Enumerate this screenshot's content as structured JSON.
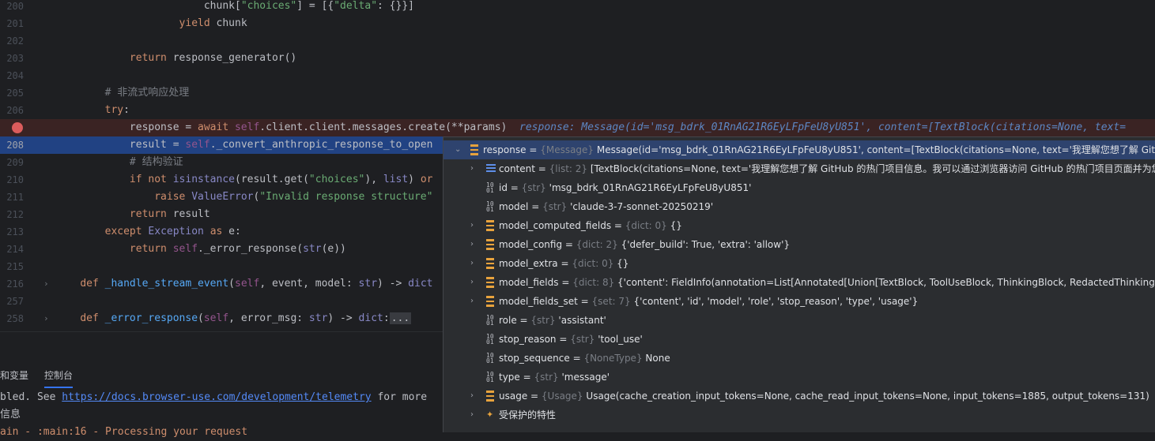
{
  "editor": {
    "lines": [
      {
        "num": "200",
        "code": [
          [
            "",
            "                        chunk["
          ],
          [
            "str",
            "\"choices\""
          ],
          [
            "",
            "] = [{"
          ],
          [
            "str",
            "\"delta\""
          ],
          [
            "",
            ": {}}]"
          ]
        ]
      },
      {
        "num": "201",
        "code": [
          [
            "",
            "                    "
          ],
          [
            "kw",
            "yield"
          ],
          [
            "",
            " chunk"
          ]
        ]
      },
      {
        "num": "202",
        "code": [
          [
            "",
            ""
          ]
        ]
      },
      {
        "num": "203",
        "code": [
          [
            "",
            "            "
          ],
          [
            "kw",
            "return"
          ],
          [
            "",
            " response_generator()"
          ]
        ]
      },
      {
        "num": "204",
        "code": [
          [
            "",
            ""
          ]
        ]
      },
      {
        "num": "205",
        "code": [
          [
            "",
            "        "
          ],
          [
            "cm",
            "# 非流式响应处理"
          ]
        ]
      },
      {
        "num": "206",
        "code": [
          [
            "",
            "        "
          ],
          [
            "kw",
            "try"
          ],
          [
            "",
            ":"
          ]
        ]
      },
      {
        "num": "",
        "code": [
          [
            "",
            "            response = "
          ],
          [
            "kw",
            "await"
          ],
          [
            "",
            " "
          ],
          [
            "self",
            "self"
          ],
          [
            "",
            ".client.client.messages.create(**params)  "
          ],
          [
            "inline-hint",
            "response: Message(id='msg_bdrk_01RnAG21R6EyLFpFeU8yU851', content=[TextBlock(citations=None, text="
          ]
        ]
      },
      {
        "num": "208",
        "code": [
          [
            "",
            "            result = "
          ],
          [
            "self",
            "self"
          ],
          [
            "",
            "._convert_anthropic_response_to_open"
          ]
        ]
      },
      {
        "num": "209",
        "code": [
          [
            "",
            "            "
          ],
          [
            "cm",
            "# 结构验证"
          ]
        ]
      },
      {
        "num": "210",
        "code": [
          [
            "",
            "            "
          ],
          [
            "kw",
            "if not"
          ],
          [
            "",
            " "
          ],
          [
            "bi",
            "isinstance"
          ],
          [
            "",
            "(result.get("
          ],
          [
            "str",
            "\"choices\""
          ],
          [
            "",
            "), "
          ],
          [
            "bi",
            "list"
          ],
          [
            "",
            ") "
          ],
          [
            "kw",
            "or"
          ]
        ]
      },
      {
        "num": "211",
        "code": [
          [
            "",
            "                "
          ],
          [
            "kw",
            "raise"
          ],
          [
            "",
            " "
          ],
          [
            "bi",
            "ValueError"
          ],
          [
            "",
            "("
          ],
          [
            "str",
            "\"Invalid response structure\""
          ]
        ]
      },
      {
        "num": "212",
        "code": [
          [
            "",
            "            "
          ],
          [
            "kw",
            "return"
          ],
          [
            "",
            " result"
          ]
        ]
      },
      {
        "num": "213",
        "code": [
          [
            "",
            "        "
          ],
          [
            "kw",
            "except"
          ],
          [
            "",
            " "
          ],
          [
            "bi",
            "Exception"
          ],
          [
            "",
            " "
          ],
          [
            "kw",
            "as"
          ],
          [
            "",
            " e:"
          ]
        ]
      },
      {
        "num": "214",
        "code": [
          [
            "",
            "            "
          ],
          [
            "kw",
            "return"
          ],
          [
            "",
            " "
          ],
          [
            "self",
            "self"
          ],
          [
            "",
            "._error_response("
          ],
          [
            "bi",
            "str"
          ],
          [
            "",
            "(e))"
          ]
        ]
      },
      {
        "num": "215",
        "code": [
          [
            "",
            ""
          ]
        ]
      },
      {
        "num": "216",
        "code": [
          [
            "",
            "    "
          ],
          [
            "kw",
            "def"
          ],
          [
            "",
            " "
          ],
          [
            "fn",
            "_handle_stream_event"
          ],
          [
            "",
            "("
          ],
          [
            "self",
            "self"
          ],
          [
            "",
            ", event, model: "
          ],
          [
            "bi",
            "str"
          ],
          [
            "",
            ") -> "
          ],
          [
            "bi",
            "dict"
          ]
        ]
      },
      {
        "num": "257",
        "code": [
          [
            "",
            ""
          ]
        ]
      },
      {
        "num": "258",
        "code": [
          [
            "",
            "    "
          ],
          [
            "kw",
            "def"
          ],
          [
            "",
            " "
          ],
          [
            "fn",
            "_error_response"
          ],
          [
            "",
            "("
          ],
          [
            "self",
            "self"
          ],
          [
            "",
            ", error_msg: "
          ],
          [
            "bi",
            "str"
          ],
          [
            "",
            ") -> "
          ],
          [
            "bi",
            "dict"
          ],
          [
            "",
            ":"
          ],
          [
            "fold-box",
            "..."
          ]
        ]
      }
    ]
  },
  "bottom_panel": {
    "tab_variables": "和变量",
    "tab_console": "控制台",
    "console_line1_prefix": "bled. See ",
    "console_link": "https://docs.browser-use.com/development/telemetry",
    "console_line1_suffix": " for more",
    "console_line2": "信息",
    "console_line3": "ain - :main:16 - Processing your request"
  },
  "debugger": {
    "rows": [
      {
        "level": 0,
        "arrow": "⌄",
        "icon": "obj",
        "name": "response",
        "type": "{Message}",
        "value": "Message(id='msg_bdrk_01RnAG21R6EyLFpFeU8yU851', content=[TextBlock(citations=None, text='我理解您想了解 GitHub 的",
        "selected": true
      },
      {
        "level": 1,
        "arrow": "›",
        "icon": "list",
        "name": "content",
        "type": "{list: 2}",
        "value": "[TextBlock(citations=None, text='我理解您想了解 GitHub 的热门项目信息。我可以通过浏览器访问 GitHub 的热门项目页面并为您获取"
      },
      {
        "level": 1,
        "arrow": "",
        "icon": "bin",
        "name": "id",
        "type": "{str}",
        "value": "'msg_bdrk_01RnAG21R6EyLFpFeU8yU851'"
      },
      {
        "level": 1,
        "arrow": "",
        "icon": "bin",
        "name": "model",
        "type": "{str}",
        "value": "'claude-3-7-sonnet-20250219'"
      },
      {
        "level": 1,
        "arrow": "›",
        "icon": "obj",
        "name": "model_computed_fields",
        "type": "{dict: 0}",
        "value": "{}"
      },
      {
        "level": 1,
        "arrow": "›",
        "icon": "obj",
        "name": "model_config",
        "type": "{dict: 2}",
        "value": "{'defer_build': True, 'extra': 'allow'}"
      },
      {
        "level": 1,
        "arrow": "›",
        "icon": "obj",
        "name": "model_extra",
        "type": "{dict: 0}",
        "value": "{}"
      },
      {
        "level": 1,
        "arrow": "›",
        "icon": "obj",
        "name": "model_fields",
        "type": "{dict: 8}",
        "value": "{'content': FieldInfo(annotation=List[Annotated[Union[TextBlock, ToolUseBlock, ThinkingBlock, RedactedThinkingBlock],"
      },
      {
        "level": 1,
        "arrow": "›",
        "icon": "obj",
        "name": "model_fields_set",
        "type": "{set: 7}",
        "value": "{'content', 'id', 'model', 'role', 'stop_reason', 'type', 'usage'}"
      },
      {
        "level": 1,
        "arrow": "",
        "icon": "bin",
        "name": "role",
        "type": "{str}",
        "value": "'assistant'"
      },
      {
        "level": 1,
        "arrow": "",
        "icon": "bin",
        "name": "stop_reason",
        "type": "{str}",
        "value": "'tool_use'"
      },
      {
        "level": 1,
        "arrow": "",
        "icon": "bin",
        "name": "stop_sequence",
        "type": "{NoneType}",
        "value": "None"
      },
      {
        "level": 1,
        "arrow": "",
        "icon": "bin",
        "name": "type",
        "type": "{str}",
        "value": "'message'"
      },
      {
        "level": 1,
        "arrow": "›",
        "icon": "obj",
        "name": "usage",
        "type": "{Usage}",
        "value": "Usage(cache_creation_input_tokens=None, cache_read_input_tokens=None, input_tokens=1885, output_tokens=131)"
      },
      {
        "level": 1,
        "arrow": "›",
        "icon": "prot",
        "name": "受保护的特性",
        "type": "",
        "value": ""
      }
    ]
  }
}
